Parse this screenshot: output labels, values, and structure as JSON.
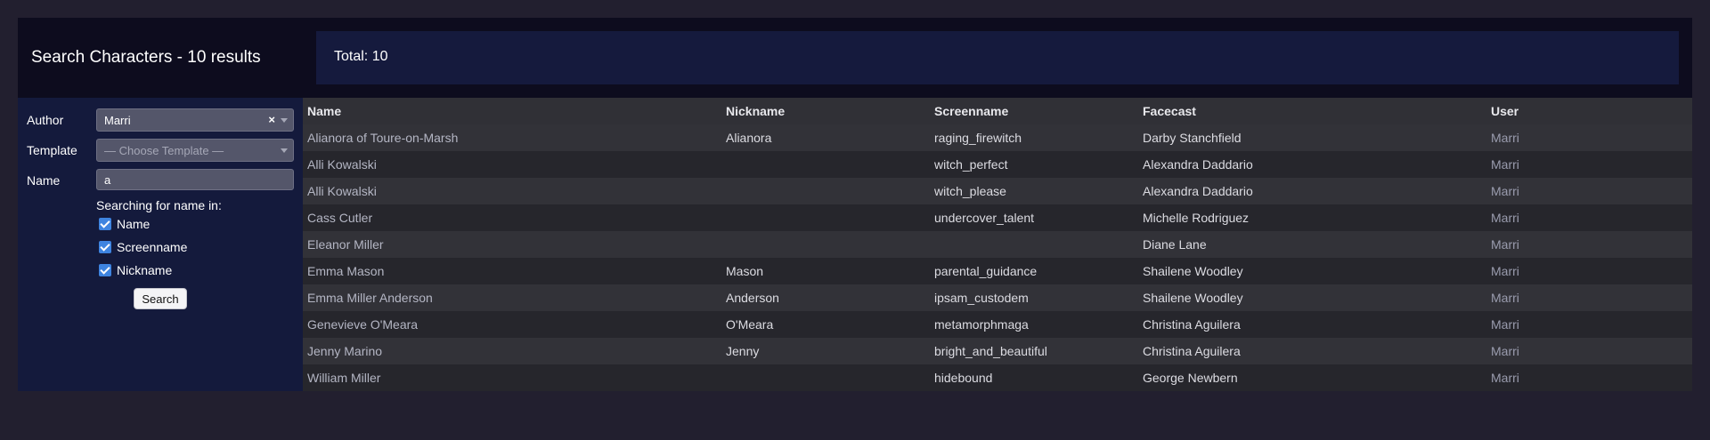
{
  "header": {
    "title": "Search Characters - 10 results",
    "total": "Total: 10"
  },
  "sidebar": {
    "author": {
      "label": "Author",
      "value": "Marri",
      "clear": "×"
    },
    "template": {
      "label": "Template",
      "placeholder": "— Choose Template —"
    },
    "name": {
      "label": "Name",
      "value": "a"
    },
    "search_hint": "Searching for name in:",
    "options": [
      {
        "label": "Name",
        "checked": true
      },
      {
        "label": "Screenname",
        "checked": true
      },
      {
        "label": "Nickname",
        "checked": true
      }
    ],
    "search_label": "Search"
  },
  "table": {
    "columns": [
      "Name",
      "Nickname",
      "Screenname",
      "Facecast",
      "User"
    ],
    "rows": [
      {
        "name": "Alianora of Toure-on-Marsh",
        "nickname": "Alianora",
        "screenname": "raging_firewitch",
        "facecast": "Darby Stanchfield",
        "user": "Marri"
      },
      {
        "name": "Alli Kowalski",
        "nickname": "",
        "screenname": "witch_perfect",
        "facecast": "Alexandra Daddario",
        "user": "Marri"
      },
      {
        "name": "Alli Kowalski",
        "nickname": "",
        "screenname": "witch_please",
        "facecast": "Alexandra Daddario",
        "user": "Marri"
      },
      {
        "name": "Cass Cutler",
        "nickname": "",
        "screenname": "undercover_talent",
        "facecast": "Michelle Rodriguez",
        "user": "Marri"
      },
      {
        "name": "Eleanor Miller",
        "nickname": "",
        "screenname": "",
        "facecast": "Diane Lane",
        "user": "Marri"
      },
      {
        "name": "Emma Mason",
        "nickname": "Mason",
        "screenname": "parental_guidance",
        "facecast": "Shailene Woodley",
        "user": "Marri"
      },
      {
        "name": "Emma Miller Anderson",
        "nickname": "Anderson",
        "screenname": "ipsam_custodem",
        "facecast": "Shailene Woodley",
        "user": "Marri"
      },
      {
        "name": "Genevieve O'Meara",
        "nickname": "O'Meara",
        "screenname": "metamorphmaga",
        "facecast": "Christina Aguilera",
        "user": "Marri"
      },
      {
        "name": "Jenny Marino",
        "nickname": "Jenny",
        "screenname": "bright_and_beautiful",
        "facecast": "Christina Aguilera",
        "user": "Marri"
      },
      {
        "name": "William Miller",
        "nickname": "",
        "screenname": "hidebound",
        "facecast": "George Newbern",
        "user": "Marri"
      }
    ]
  },
  "colors": {
    "page_bg": "#221f2f",
    "header_bg": "#0d0c1e",
    "total_bg": "#151a3d",
    "sidebar_bg": "#141a3c",
    "checkbox": "#3e84e0"
  }
}
